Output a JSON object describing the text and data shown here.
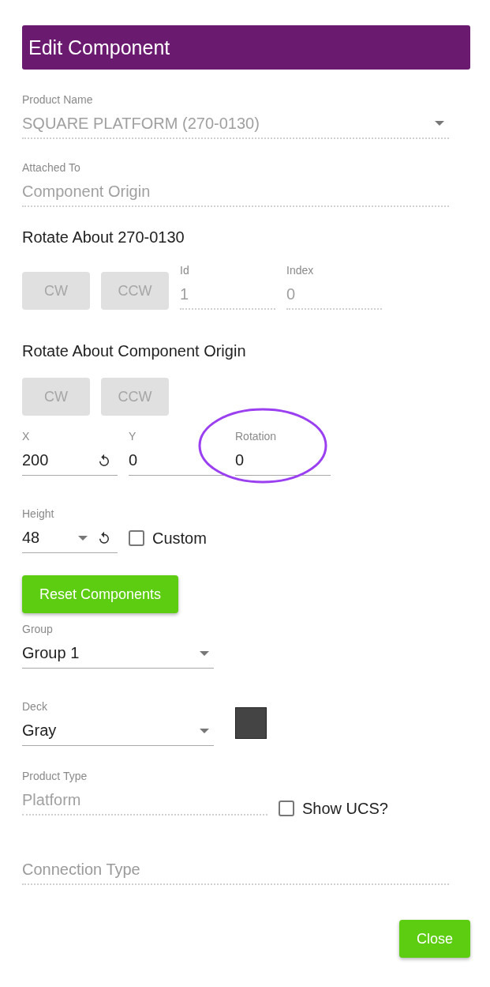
{
  "dialog_title": "Edit Component",
  "product_name": {
    "kind": "select",
    "label": "Product Name",
    "value": "SQUARE PLATFORM (270-0130)",
    "disabled": true
  },
  "attached_to": {
    "kind": "text",
    "label": "Attached To",
    "value": "Component Origin",
    "disabled": true
  },
  "rotate_about_part": {
    "heading": "Rotate About 270-0130",
    "buttons": [
      {
        "label": "CW",
        "disabled": true
      },
      {
        "label": "CCW",
        "disabled": true
      }
    ],
    "fields": [
      {
        "kind": "text",
        "label": "Id",
        "value": "1",
        "disabled": true
      },
      {
        "kind": "text",
        "label": "Index",
        "value": "0",
        "disabled": true
      }
    ]
  },
  "rotate_about_origin": {
    "heading": "Rotate About Component Origin",
    "buttons": [
      {
        "label": "CW",
        "disabled": true
      },
      {
        "label": "CCW",
        "disabled": true
      }
    ]
  },
  "position": [
    {
      "kind": "text",
      "label": "X",
      "value": "200",
      "disabled": false,
      "resettable": true,
      "highlighted": false
    },
    {
      "kind": "text",
      "label": "Y",
      "value": "0",
      "disabled": false,
      "resettable": false,
      "highlighted": false
    },
    {
      "kind": "text",
      "label": "Rotation",
      "value": "0",
      "disabled": false,
      "resettable": false,
      "highlighted": true
    }
  ],
  "height": {
    "kind": "select",
    "label": "Height",
    "value": "48",
    "disabled": false,
    "resettable": true
  },
  "custom": {
    "label": "Custom",
    "checked": false
  },
  "reset_button": {
    "label": "Reset Components",
    "disabled": false
  },
  "group": {
    "kind": "select",
    "label": "Group",
    "value": "Group 1",
    "disabled": false
  },
  "deck": {
    "kind": "select",
    "label": "Deck",
    "value": "Gray",
    "disabled": false,
    "color": "#444444"
  },
  "product_type": {
    "kind": "text",
    "label": "Product Type",
    "value": "Platform",
    "disabled": true
  },
  "show_ucs": {
    "label": "Show UCS?",
    "checked": false
  },
  "connection_type": {
    "kind": "input",
    "placeholder": "Connection Type",
    "disabled": true
  },
  "close_button": {
    "label": "Close",
    "disabled": false
  }
}
